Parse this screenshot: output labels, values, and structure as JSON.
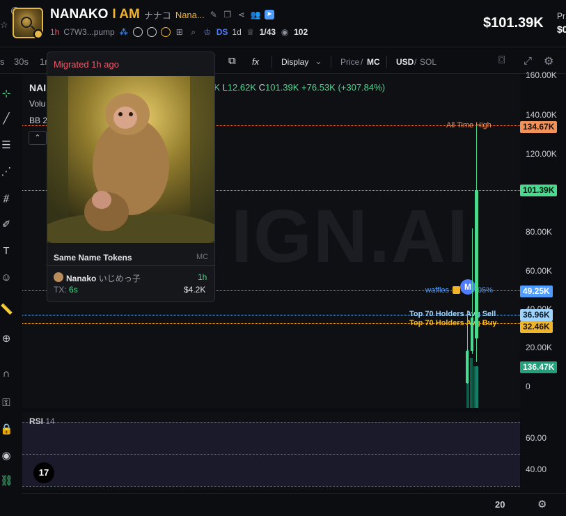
{
  "header": {
    "symbol": "NANAKO",
    "name": "I AM",
    "name_jp": "ナナコ",
    "alias": "Nana...",
    "age": "1h",
    "address": "C7W3...pump",
    "ds_label": "DS",
    "ds_age": "1d",
    "holders_ratio": "1/43",
    "watchers": "102",
    "price": "$101.39K",
    "pr_label": "Pr",
    "pr_value": "$0"
  },
  "toolbar": {
    "tf_s": "s",
    "tf_30s": "30s",
    "tf_1m": "1m",
    "display": "Display",
    "price_label": "Price",
    "mc_label": "MC",
    "usd_label": "USD",
    "sol_label": "SOL",
    "fx_label": "fx"
  },
  "legend": {
    "nan": "NAI",
    "vol": "Volu",
    "bb": "BB 2"
  },
  "ohlc": {
    "h_val": "7K",
    "l_label": "L",
    "l_val": "12.62K",
    "c_label": "C",
    "c_val": "101.39K",
    "change": "+76.53K (+307.84%)"
  },
  "watermark": "IGN.AI",
  "lines": {
    "ath_label": "All Time High",
    "waffles_label": "waffles",
    "waffles_pct": "05%",
    "m_badge": "M",
    "top70_sell_label": "Top 70 Holders Avg Sell",
    "top70_buy_label": "Top 70 Holders Avg Buy"
  },
  "yaxis": {
    "ticks": [
      "160.00K",
      "140.00K",
      "120.00K",
      "80.00K",
      "60.00K",
      "40.00K",
      "20.00K",
      "0"
    ],
    "tag_ath": "134.67K",
    "tag_price": "101.39K",
    "tag_waffles": "49.25K",
    "tag_sell": "36.96K",
    "tag_buy": "32.46K",
    "tag_volume": "136.47K"
  },
  "colors": {
    "ath": "#f0925a",
    "price": "#4bd88f",
    "waffles": "#4f9cff",
    "sell": "#9fd4ff",
    "buy": "#f0b429",
    "volume": "#22a07a"
  },
  "rsi": {
    "label": "RSI",
    "period": "14",
    "tick_60": "60.00",
    "tick_40": "40.00"
  },
  "xaxis": {
    "label": "20"
  },
  "popover": {
    "migrated": "Migrated 1h ago",
    "same_name_title": "Same Name Tokens",
    "mc_header": "MC",
    "token_name": "Nanako",
    "token_jp": "いじめっ子",
    "token_age": "1h",
    "tx_label": "TX:",
    "tx_value": "6s",
    "mc_value": "$4.2K"
  },
  "tv_logo": "17"
}
